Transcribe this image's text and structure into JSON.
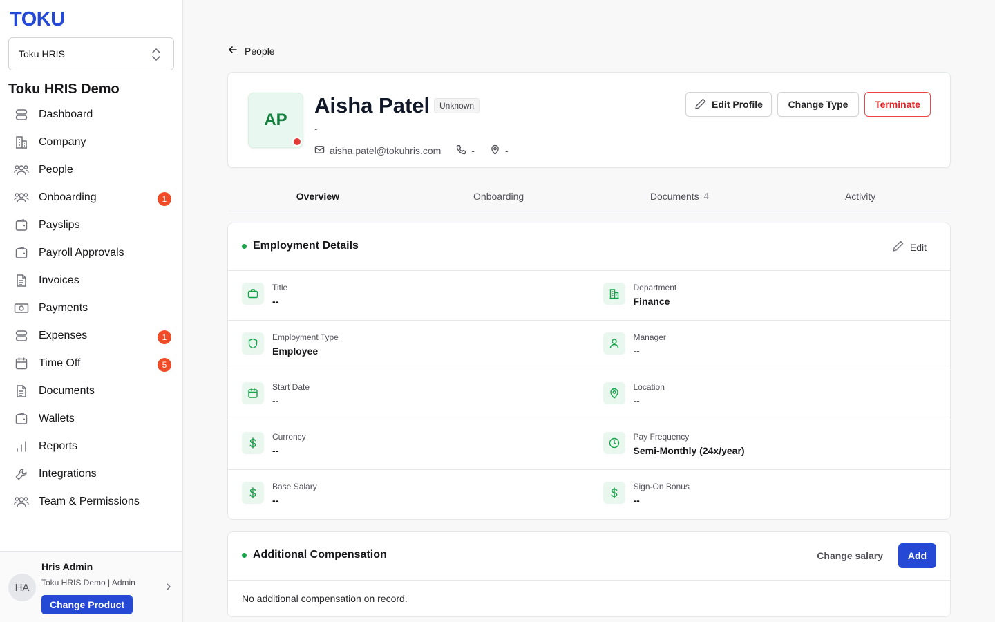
{
  "sidebar": {
    "logo": "TOKU",
    "org_select": "Toku HRIS",
    "org_title": "Toku HRIS Demo",
    "items": [
      {
        "label": "Dashboard",
        "icon": "database-icon",
        "badge": ""
      },
      {
        "label": "Company",
        "icon": "building-icon",
        "badge": ""
      },
      {
        "label": "People",
        "icon": "people-icon",
        "badge": ""
      },
      {
        "label": "Onboarding",
        "icon": "people-icon",
        "badge": "1"
      },
      {
        "label": "Payslips",
        "icon": "wallet-icon",
        "badge": ""
      },
      {
        "label": "Payroll Approvals",
        "icon": "wallet-icon",
        "badge": ""
      },
      {
        "label": "Invoices",
        "icon": "document-icon",
        "badge": ""
      },
      {
        "label": "Payments",
        "icon": "banknote-icon",
        "badge": ""
      },
      {
        "label": "Expenses",
        "icon": "database-icon",
        "badge": "1"
      },
      {
        "label": "Time Off",
        "icon": "calendar-icon",
        "badge": "5"
      },
      {
        "label": "Documents",
        "icon": "document-icon",
        "badge": ""
      },
      {
        "label": "Wallets",
        "icon": "wallet-icon",
        "badge": ""
      },
      {
        "label": "Reports",
        "icon": "bar-chart-icon",
        "badge": ""
      },
      {
        "label": "Integrations",
        "icon": "wrench-icon",
        "badge": ""
      },
      {
        "label": "Team & Permissions",
        "icon": "people-icon",
        "badge": ""
      }
    ],
    "footer": {
      "initials": "HA",
      "name": "Hris Admin",
      "org": "Toku HRIS Demo | Admin",
      "change_product": "Change Product"
    }
  },
  "back_link": "People",
  "profile": {
    "initials": "AP",
    "name": "Aisha Patel",
    "tag": "Unknown",
    "subtitle": "-",
    "email": "aisha.patel@tokuhris.com",
    "phone": "-",
    "location": "-",
    "status_color": "#e53935",
    "buttons": {
      "edit": "Edit Profile",
      "change_type": "Change Type",
      "terminate": "Terminate"
    }
  },
  "tabs": [
    {
      "label": "Overview",
      "count": ""
    },
    {
      "label": "Onboarding",
      "count": ""
    },
    {
      "label": "Documents",
      "count": "4"
    },
    {
      "label": "Activity",
      "count": ""
    }
  ],
  "employment": {
    "title": "Employment Details",
    "edit": "Edit",
    "rows": [
      [
        {
          "label": "Title",
          "value": "--",
          "icon": "briefcase-icon"
        },
        {
          "label": "Department",
          "value": "Finance",
          "icon": "building-icon"
        }
      ],
      [
        {
          "label": "Employment Type",
          "value": "Employee",
          "icon": "shield-icon"
        },
        {
          "label": "Manager",
          "value": "--",
          "icon": "user-icon"
        }
      ],
      [
        {
          "label": "Start Date",
          "value": "--",
          "icon": "calendar-icon"
        },
        {
          "label": "Location",
          "value": "--",
          "icon": "map-pin-icon"
        }
      ],
      [
        {
          "label": "Currency",
          "value": "--",
          "icon": "dollar-icon"
        },
        {
          "label": "Pay Frequency",
          "value": "Semi-Monthly (24x/year)",
          "icon": "clock-icon"
        }
      ],
      [
        {
          "label": "Base Salary",
          "value": "--",
          "icon": "dollar-icon"
        },
        {
          "label": "Sign-On Bonus",
          "value": "--",
          "icon": "dollar-icon"
        }
      ]
    ]
  },
  "compensation": {
    "title": "Additional Compensation",
    "change_salary": "Change salary",
    "add": "Add",
    "empty": "No additional compensation on record."
  },
  "colors": {
    "brand": "#2549d4",
    "badge": "#ef4b27",
    "accent_green": "#16a34a",
    "danger": "#dc2626"
  }
}
